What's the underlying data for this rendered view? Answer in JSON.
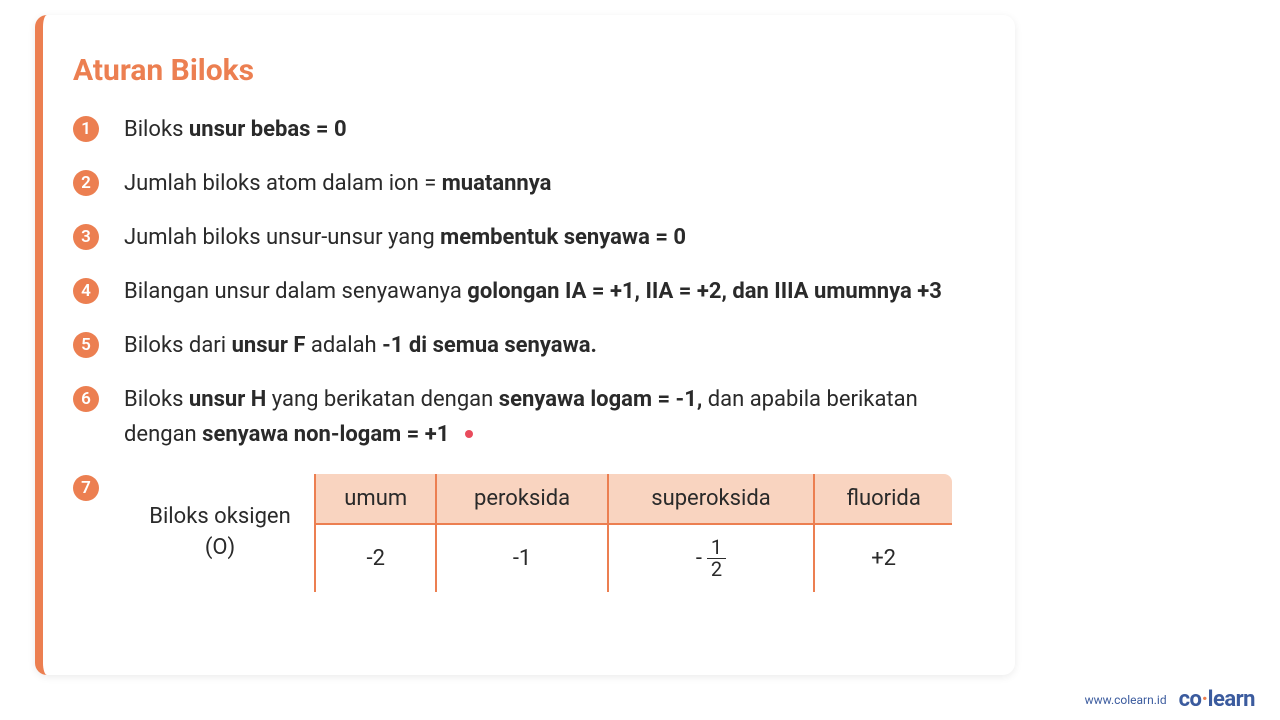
{
  "title": "Aturan Biloks",
  "rules": {
    "r1_pre": "Biloks ",
    "r1_bold": "unsur bebas = 0",
    "r2_pre": "Jumlah biloks atom dalam ion = ",
    "r2_bold": "muatannya",
    "r3_pre": "Jumlah biloks unsur-unsur yang ",
    "r3_bold": "membentuk senyawa = 0",
    "r4_pre": "Bilangan unsur dalam senyawanya ",
    "r4_bold": "golongan IA = +1, IIA = +2, dan IIIA umumnya +3",
    "r5_pre": "Biloks dari ",
    "r5_bold1": "unsur F",
    "r5_mid": " adalah ",
    "r5_bold2": "-1 di semua senyawa.",
    "r6_pre": "Biloks ",
    "r6_bold1": "unsur H",
    "r6_mid1": " yang berikatan dengan ",
    "r6_bold2": "senyawa logam = -1,",
    "r6_mid2": " dan apabila berikatan dengan ",
    "r6_bold3": "senyawa non-logam = +1"
  },
  "numbers": {
    "n1": "1",
    "n2": "2",
    "n3": "3",
    "n4": "4",
    "n5": "5",
    "n6": "6",
    "n7": "7"
  },
  "table": {
    "row_header": "Biloks oksigen (O)",
    "headers": {
      "h1": "umum",
      "h2": "peroksida",
      "h3": "superoksida",
      "h4": "fluorida"
    },
    "values": {
      "v1": "-2",
      "v2": "-1",
      "v3_sign": "-",
      "v3_num": "1",
      "v3_den": "2",
      "v4": "+2"
    }
  },
  "footer": {
    "url": "www.colearn.id",
    "logo_left": "co",
    "logo_dot": "·",
    "logo_right": "learn"
  }
}
